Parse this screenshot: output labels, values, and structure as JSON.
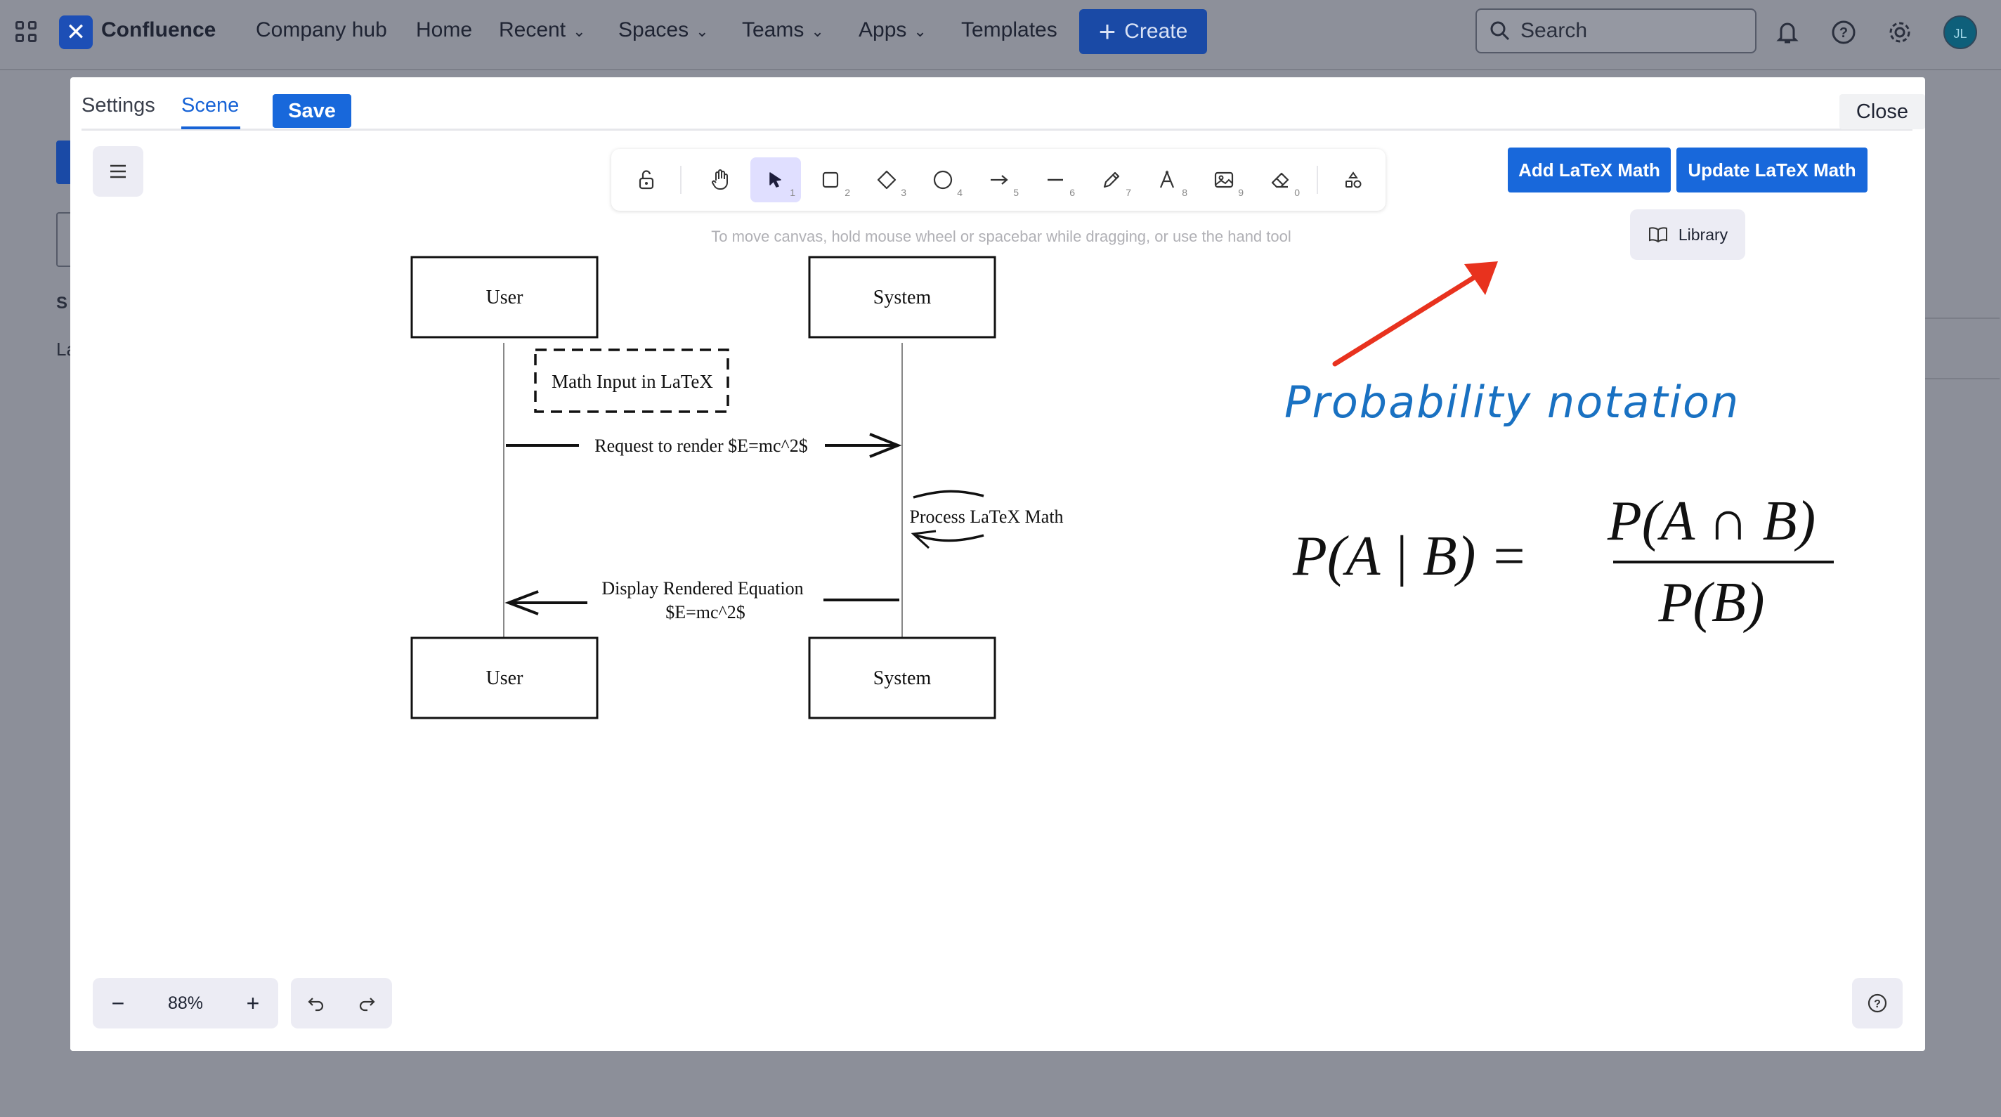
{
  "topnav": {
    "brand": "Confluence",
    "items": [
      {
        "label": "Company hub",
        "chevron": false
      },
      {
        "label": "Home",
        "chevron": false
      },
      {
        "label": "Recent",
        "chevron": true
      },
      {
        "label": "Spaces",
        "chevron": true
      },
      {
        "label": "Teams",
        "chevron": true
      },
      {
        "label": "Apps",
        "chevron": true
      },
      {
        "label": "Templates",
        "chevron": false
      }
    ],
    "create_label": "Create",
    "search_placeholder": "Search",
    "avatar_initials": "JL"
  },
  "background_page": {
    "section_label": "S",
    "item_label": "La"
  },
  "modal": {
    "tabs": {
      "settings": "Settings",
      "scene": "Scene"
    },
    "save_label": "Save",
    "close_label": "Close",
    "toolbar": {
      "tools": [
        {
          "icon": "lock-open-icon",
          "num": ""
        },
        {
          "icon": "hand-icon",
          "num": ""
        },
        {
          "icon": "selection-arrow-icon",
          "num": "1",
          "active": true
        },
        {
          "icon": "rectangle-icon",
          "num": "2"
        },
        {
          "icon": "diamond-icon",
          "num": "3"
        },
        {
          "icon": "ellipse-icon",
          "num": "4"
        },
        {
          "icon": "arrow-icon",
          "num": "5"
        },
        {
          "icon": "line-icon",
          "num": "6"
        },
        {
          "icon": "pencil-icon",
          "num": "7"
        },
        {
          "icon": "text-icon",
          "num": "8"
        },
        {
          "icon": "image-icon",
          "num": "9"
        },
        {
          "icon": "eraser-icon",
          "num": "0"
        },
        {
          "icon": "shapes-library-icon",
          "num": ""
        }
      ]
    },
    "hint": "To move canvas, hold mouse wheel or spacebar while dragging, or use the hand tool",
    "add_latex_label": "Add LaTeX Math",
    "update_latex_label": "Update LaTeX Math",
    "library_label": "Library",
    "diagram": {
      "actor_top_left": "User",
      "actor_top_right": "System",
      "actor_bottom_left": "User",
      "actor_bottom_right": "System",
      "note": "Math Input in LaTeX",
      "msg1": "Request to render $E=mc^2$",
      "msg2": "Process LaTeX Math",
      "msg3_line1": "Display Rendered Equation",
      "msg3_line2": "$E=mc^2$"
    },
    "handwritten_title": "Probability notation",
    "formula": {
      "lhs": "P(A | B) =",
      "numerator": "P(A ∩ B)",
      "denominator": "P(B)"
    },
    "zoom": {
      "value": "88%",
      "minus": "−",
      "plus": "+"
    }
  },
  "colors": {
    "primary": "#1868db",
    "overlay_bg": "#8c8f99",
    "handwriting": "#1971c2",
    "annotation_arrow": "#e8321e"
  }
}
